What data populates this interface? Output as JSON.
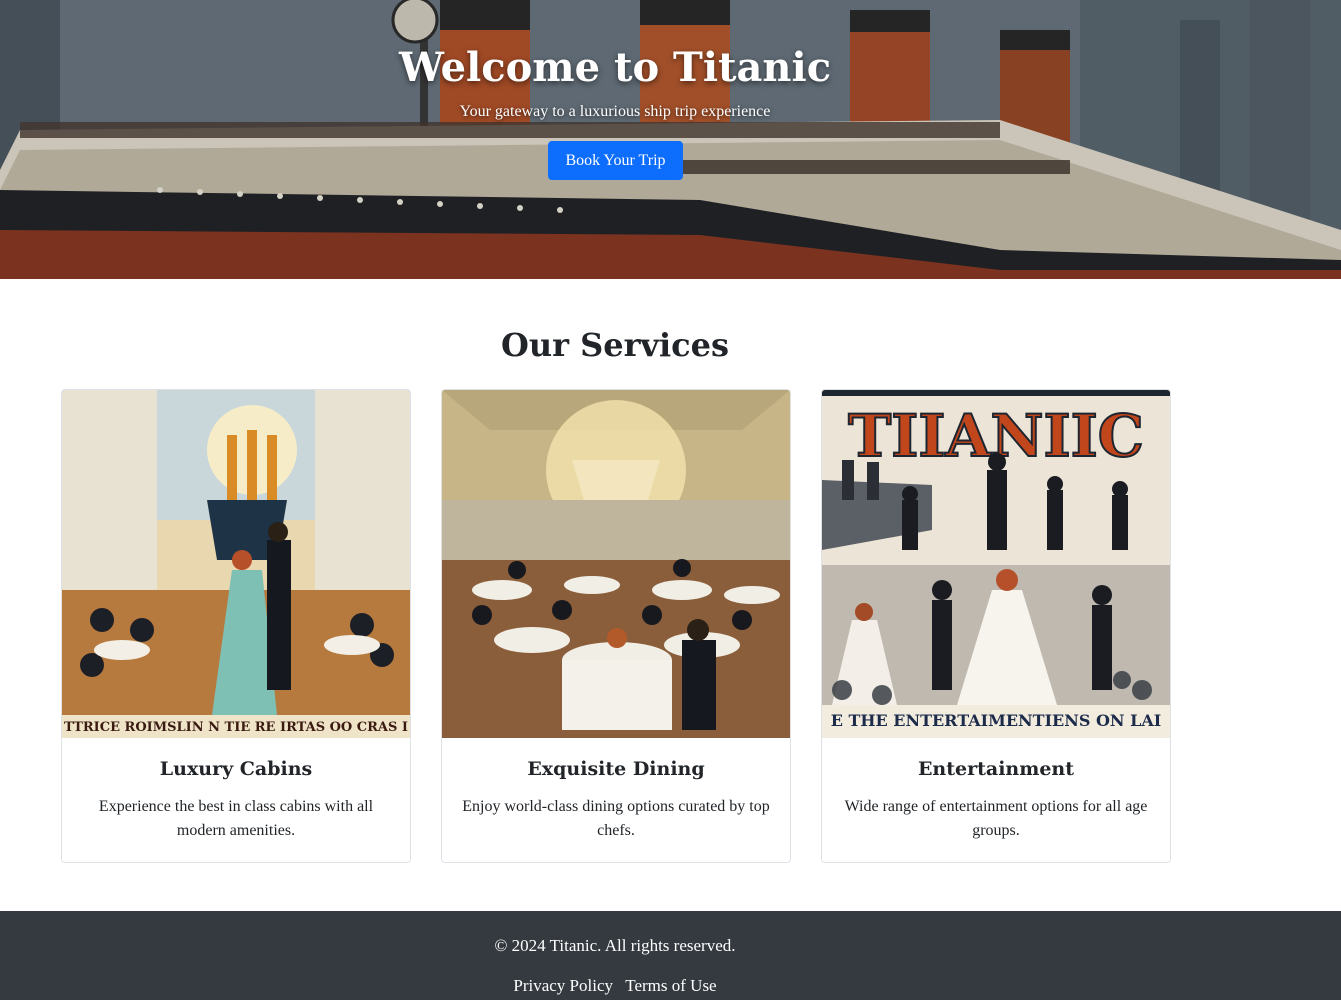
{
  "hero": {
    "title": "Welcome to Titanic",
    "subtitle": "Your gateway to a luxurious ship trip experience",
    "cta_label": "Book Your Trip"
  },
  "services": {
    "heading": "Our Services",
    "cards": [
      {
        "title": "Luxury Cabins",
        "text": "Experience the best in class cabins with all modern amenities.",
        "image": "ballroom-dancing-poster"
      },
      {
        "title": "Exquisite Dining",
        "text": "Enjoy world-class dining options curated by top chefs.",
        "image": "grand-dining-hall-painting"
      },
      {
        "title": "Entertainment",
        "text": "Wide range of entertainment options for all age groups.",
        "image": "titanic-entertainment-poster",
        "poster_heading": "TIIANIIC",
        "poster_banner": "E THE ENTERTAIMENTIENS ON LAI"
      }
    ]
  },
  "footer": {
    "copyright": "© 2024 Titanic. All rights reserved.",
    "links": [
      "Privacy Policy",
      "Terms of Use"
    ]
  },
  "colors": {
    "primary": "#0d6efd",
    "footer_bg": "#343a40",
    "text": "#212529"
  }
}
